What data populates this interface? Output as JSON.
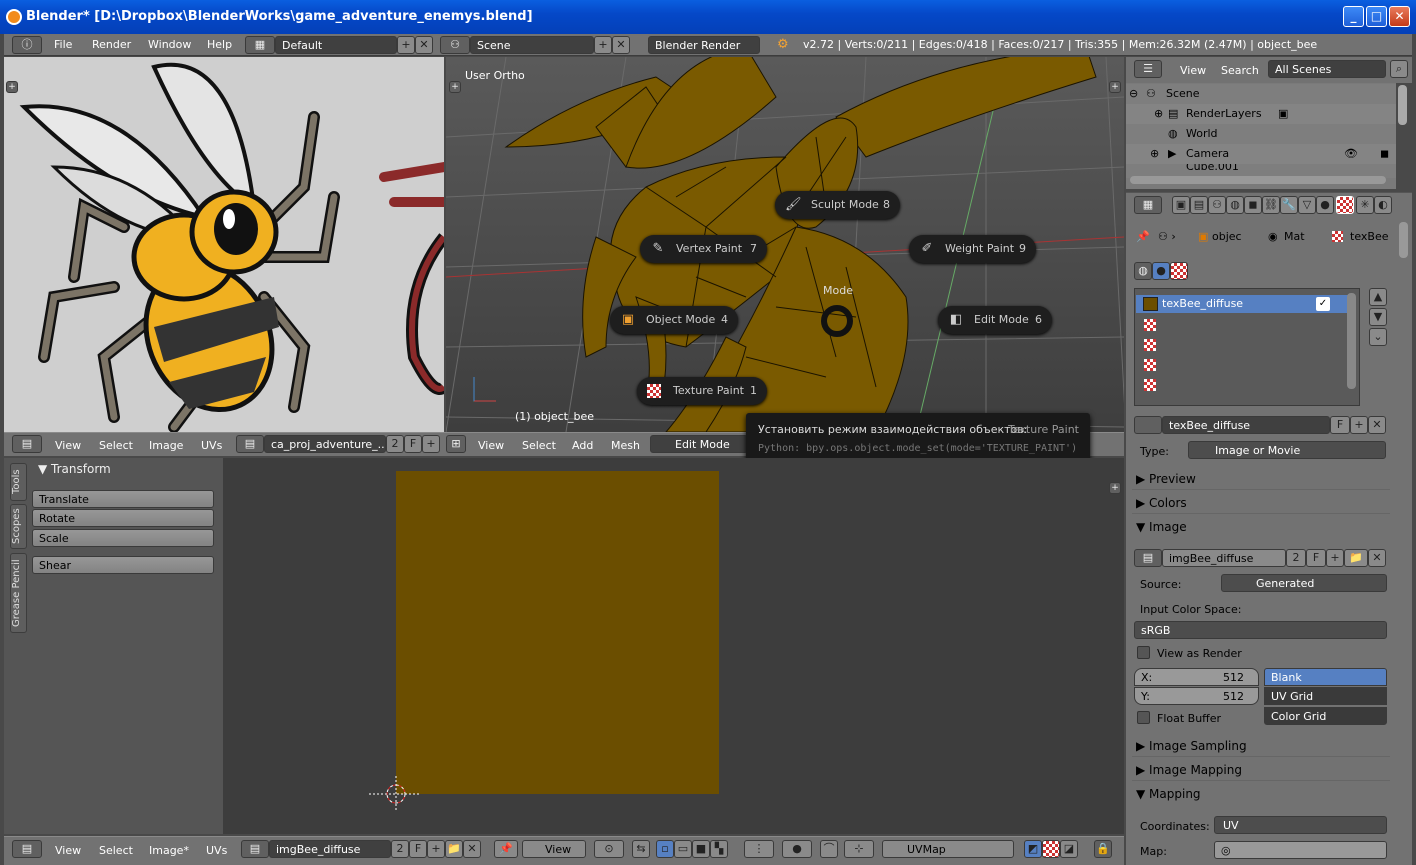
{
  "window": {
    "title": "Blender* [D:\\Dropbox\\BlenderWorks\\game_adventure_enemys.blend]"
  },
  "mainbar": {
    "menus": [
      "File",
      "Render",
      "Window",
      "Help"
    ],
    "layout": "Default",
    "scene": "Scene",
    "engine": "Blender Render",
    "stats": "v2.72 | Verts:0/211 | Edges:0/418 | Faces:0/217 | Tris:355 | Mem:26.32M (2.47M) | object_bee"
  },
  "image_editor": {
    "menus": [
      "View",
      "Select",
      "Image",
      "UVs"
    ],
    "image_name": "ca_proj_adventure_...",
    "users": "2",
    "fake": "F"
  },
  "view3d": {
    "view_label": "User Ortho",
    "object_label": "(1) object_bee",
    "menus": [
      "View",
      "Select",
      "Add",
      "Mesh"
    ],
    "mode": "Edit Mode",
    "pie": {
      "title": "Mode",
      "items": [
        {
          "label": "Sculpt Mode",
          "num": "8"
        },
        {
          "label": "Vertex Paint",
          "num": "7"
        },
        {
          "label": "Weight Paint",
          "num": "9"
        },
        {
          "label": "Object Mode",
          "num": "4"
        },
        {
          "label": "Edit Mode",
          "num": "6"
        },
        {
          "label": "Texture Paint",
          "num": "1"
        }
      ]
    },
    "tooltip": {
      "text": "Установить режим взаимодействия объектов:",
      "value": "Texture Paint",
      "python": "Python: bpy.ops.object.mode_set(mode='TEXTURE_PAINT')"
    }
  },
  "tool_shelf": {
    "tabs": [
      "Tools",
      "Scopes",
      "Grease Pencil"
    ],
    "panel_title": "Transform",
    "buttons": [
      "Translate",
      "Rotate",
      "Scale",
      "Shear"
    ]
  },
  "uv_editor": {
    "menus": [
      "View",
      "Select",
      "Image*",
      "UVs"
    ],
    "image_name": "imgBee_diffuse",
    "users": "2",
    "fake": "F",
    "view_menu": "View",
    "uvmap": "UVMap",
    "image_color": "#6b4e00"
  },
  "outliner": {
    "menus": [
      "View",
      "Search"
    ],
    "filter": "All Scenes",
    "items": [
      "Scene",
      "RenderLayers",
      "World",
      "Camera",
      "Cube.001"
    ]
  },
  "properties": {
    "breadcrumb": [
      "objec",
      "Mat",
      "texBee"
    ],
    "texture_slots": [
      "texBee_diffuse"
    ],
    "texture_name": "texBee_diffuse",
    "texture_fake": "F",
    "type_label": "Type:",
    "type_value": "Image or Movie",
    "sections": {
      "preview": "Preview",
      "colors": "Colors",
      "image": "Image",
      "image_sampling": "Image Sampling",
      "image_mapping": "Image Mapping",
      "mapping": "Mapping"
    },
    "image_name": "imgBee_diffuse",
    "image_users": "2",
    "image_fake": "F",
    "source_label": "Source:",
    "source_value": "Generated",
    "input_cs_label": "Input Color Space:",
    "input_cs_value": "sRGB",
    "view_as_render": "View as Render",
    "x_label": "X:",
    "x_value": "512",
    "y_label": "Y:",
    "y_value": "512",
    "float_buffer": "Float Buffer",
    "gen_types": [
      "Blank",
      "UV Grid",
      "Color Grid"
    ],
    "coordinates_label": "Coordinates:",
    "coordinates_value": "UV",
    "map_label": "Map:"
  },
  "colors": {
    "mesh": "#7a5a00",
    "accent": "#5680c2"
  }
}
